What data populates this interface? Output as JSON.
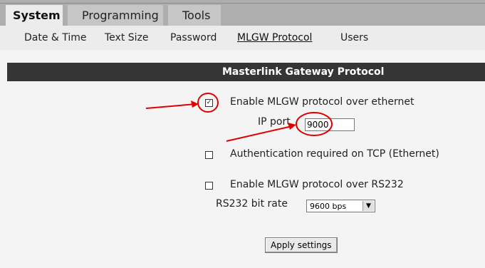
{
  "tabs": [
    {
      "label": "System",
      "active": true
    },
    {
      "label": "Programming",
      "active": false
    },
    {
      "label": "Tools",
      "active": false
    }
  ],
  "subnav": [
    {
      "label": "Date & Time",
      "active": false
    },
    {
      "label": "Text Size",
      "active": false
    },
    {
      "label": "Password",
      "active": false
    },
    {
      "label": "MLGW Protocol",
      "active": true
    },
    {
      "label": "Users",
      "active": false
    }
  ],
  "panel": {
    "title": "Masterlink Gateway Protocol",
    "enable_mlgw_ethernet": {
      "label": "Enable MLGW protocol over ethernet",
      "checked": true
    },
    "ip_port": {
      "label": "IP port",
      "value": "9000"
    },
    "auth_tcp": {
      "label": "Authentication required on TCP (Ethernet)",
      "checked": false
    },
    "enable_mlgw_rs232": {
      "label": "Enable MLGW protocol over RS232",
      "checked": false
    },
    "rs232_bitrate": {
      "label": "RS232 bit rate",
      "value": "9600 bps"
    },
    "apply_button": "Apply settings"
  },
  "colors": {
    "topbar": "#aeaeae",
    "title_bg": "#353535",
    "annotation": "#e00000"
  },
  "glyphs": {
    "check": "✓",
    "dropdown_arrow": "▼"
  }
}
